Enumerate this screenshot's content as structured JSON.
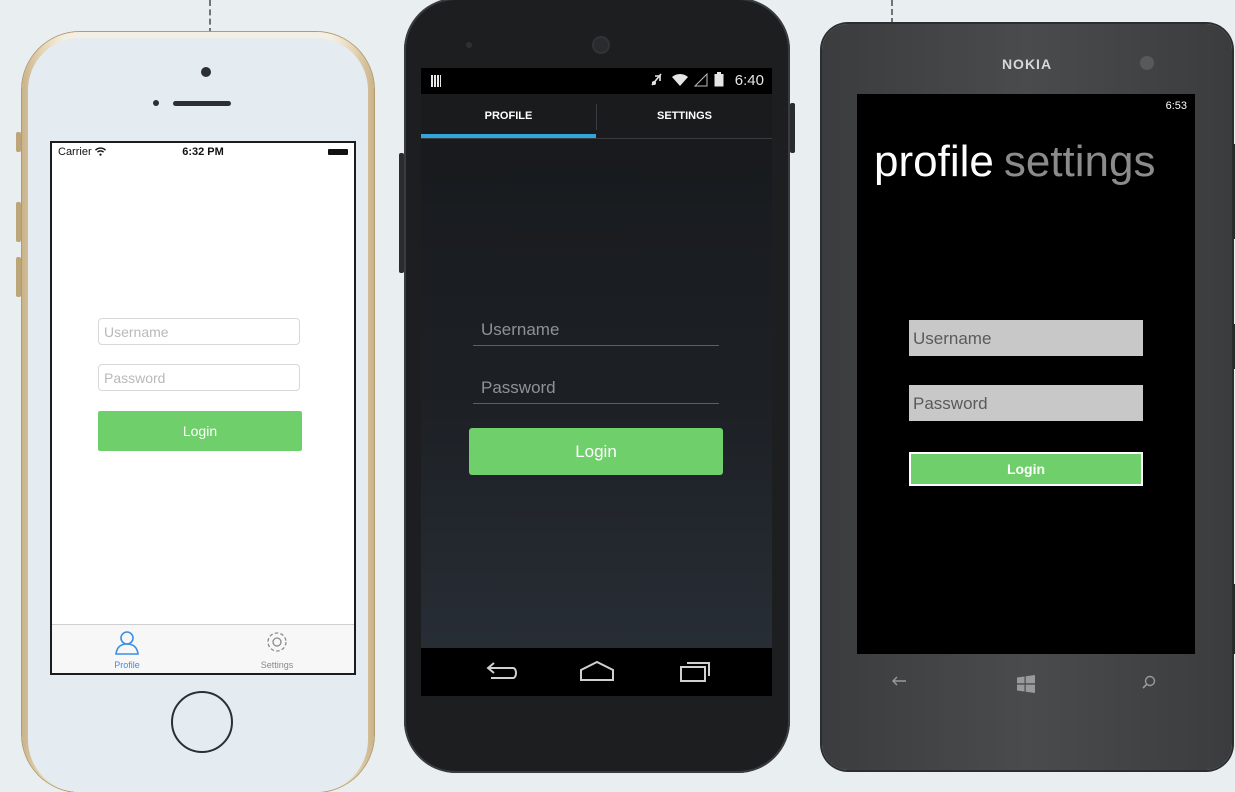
{
  "colors": {
    "background": "#e9eef1",
    "login_green": "#6fcf6a",
    "ios_tab_active": "#3b8ee6",
    "android_tab_indicator": "#33a5dd"
  },
  "ios": {
    "status": {
      "carrier": "Carrier",
      "time": "6:32 PM"
    },
    "username_placeholder": "Username",
    "password_placeholder": "Password",
    "login_label": "Login",
    "tabs": [
      {
        "label": "Profile",
        "icon": "person-icon",
        "active": true
      },
      {
        "label": "Settings",
        "icon": "gear-icon",
        "active": false
      }
    ]
  },
  "android": {
    "status": {
      "time": "6:40"
    },
    "tabs": [
      {
        "label": "PROFILE",
        "active": true
      },
      {
        "label": "SETTINGS",
        "active": false
      }
    ],
    "username_placeholder": "Username",
    "password_placeholder": "Password",
    "login_label": "Login",
    "nav": [
      "back-icon",
      "home-icon",
      "recents-icon"
    ]
  },
  "windows_phone": {
    "brand": "NOKIA",
    "status": {
      "time": "6:53"
    },
    "pivot": [
      {
        "label": "profile",
        "active": true
      },
      {
        "label": "settings",
        "active": false
      }
    ],
    "username_placeholder": "Username",
    "password_placeholder": "Password",
    "login_label": "Login",
    "nav": [
      "back-arrow-icon",
      "windows-icon",
      "search-icon"
    ]
  }
}
